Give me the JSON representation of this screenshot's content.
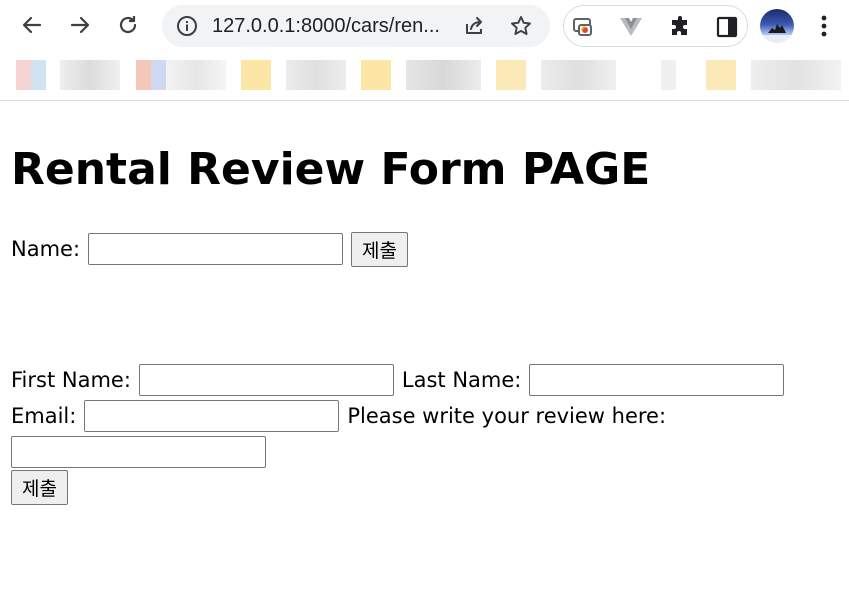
{
  "browser": {
    "url": "127.0.0.1:8000/cars/ren...",
    "icons": [
      "back-arrow-icon",
      "forward-arrow-icon",
      "reload-icon",
      "info-icon",
      "share-icon",
      "star-icon",
      "extension-screen-icon",
      "vue-devtools-icon",
      "puzzle-icon",
      "side-panel-icon",
      "profile-avatar",
      "more-menu-icon"
    ]
  },
  "page": {
    "title": "Rental Review Form PAGE",
    "form1": {
      "name_label": "Name:",
      "submit_label": "제출"
    },
    "form2": {
      "first_name_label": "First Name:",
      "last_name_label": "Last Name:",
      "email_label": "Email:",
      "review_label": "Please write your review here:",
      "submit_label": "제출"
    }
  }
}
